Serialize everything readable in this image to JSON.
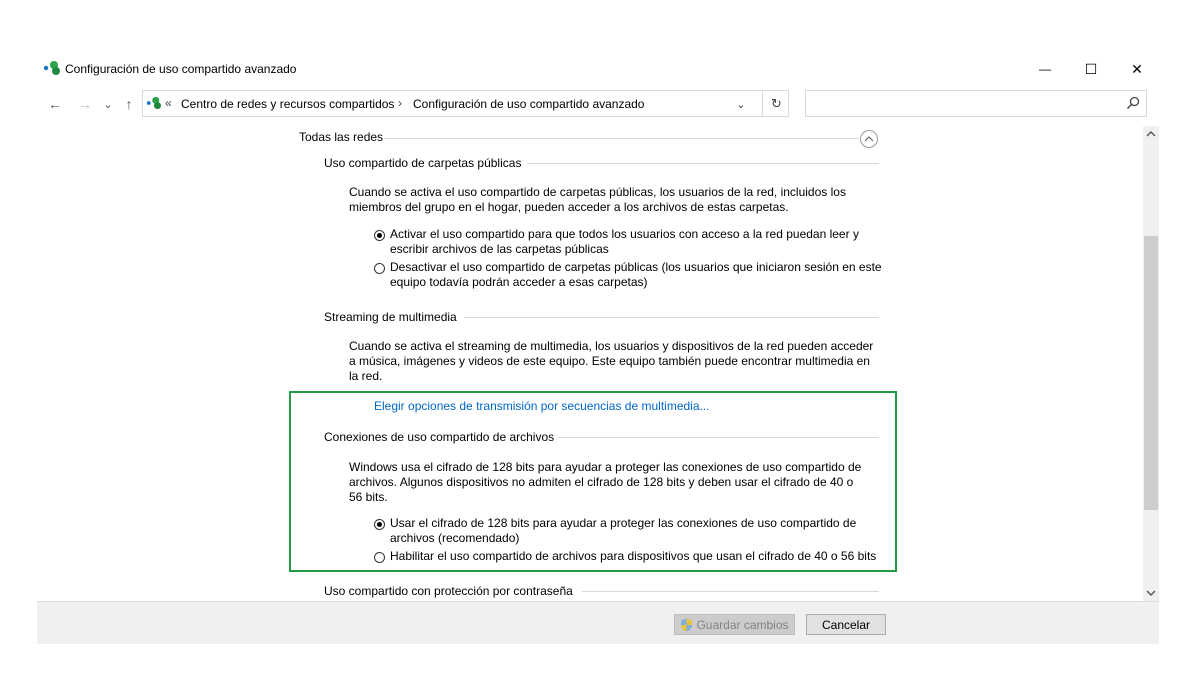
{
  "window": {
    "title": "Configuración de uso compartido avanzado",
    "controls": {
      "minimize": "—",
      "maximize": "☐",
      "close": "✕"
    }
  },
  "nav": {
    "back": "←",
    "forward": "→",
    "recent": "⌄",
    "up": "↑"
  },
  "address": {
    "overflow": "«",
    "crumbs": [
      "Centro de redes y recursos compartidos",
      "Configuración de uso compartido avanzado"
    ],
    "separator": "›",
    "dropdown": "⌄",
    "refresh": "↻"
  },
  "search": {
    "placeholder": ""
  },
  "content": {
    "section_title": "Todas las redes",
    "public_folders": {
      "heading": "Uso compartido de carpetas públicas",
      "description": "Cuando se activa el uso compartido de carpetas públicas, los usuarios de la red, incluidos los miembros del grupo en el hogar, pueden acceder a los archivos de estas carpetas.",
      "options": [
        {
          "label": "Activar el uso compartido para que todos los usuarios con acceso a la red puedan leer y escribir archivos de las carpetas públicas",
          "selected": true
        },
        {
          "label": "Desactivar el uso compartido de carpetas públicas (los usuarios que iniciaron sesión en este equipo todavía podrán acceder a esas carpetas)",
          "selected": false
        }
      ]
    },
    "streaming": {
      "heading": "Streaming de multimedia",
      "description": "Cuando se activa el streaming de multimedia, los usuarios y dispositivos de la red pueden acceder a música, imágenes y videos de este equipo. Este equipo también puede encontrar multimedia en la red.",
      "link": "Elegir opciones de transmisión por secuencias de multimedia..."
    },
    "file_sharing": {
      "heading": "Conexiones de uso compartido de archivos",
      "description": "Windows usa el cifrado de 128 bits para ayudar a proteger las conexiones de uso compartido de archivos. Algunos dispositivos no admiten el cifrado de 128 bits y deben usar el cifrado de 40 o 56 bits.",
      "options": [
        {
          "label": "Usar el cifrado de 128 bits para ayudar a proteger las conexiones de uso compartido de archivos (recomendado)",
          "selected": true
        },
        {
          "label": "Habilitar el uso compartido de archivos para dispositivos que usan el cifrado de 40 o 56 bits",
          "selected": false
        }
      ]
    },
    "password": {
      "heading": "Uso compartido con protección por contraseña"
    }
  },
  "footer": {
    "save_label": "Guardar cambios",
    "cancel_label": "Cancelar"
  },
  "colors": {
    "highlight_border": "#239a46",
    "link": "#0066cc"
  }
}
